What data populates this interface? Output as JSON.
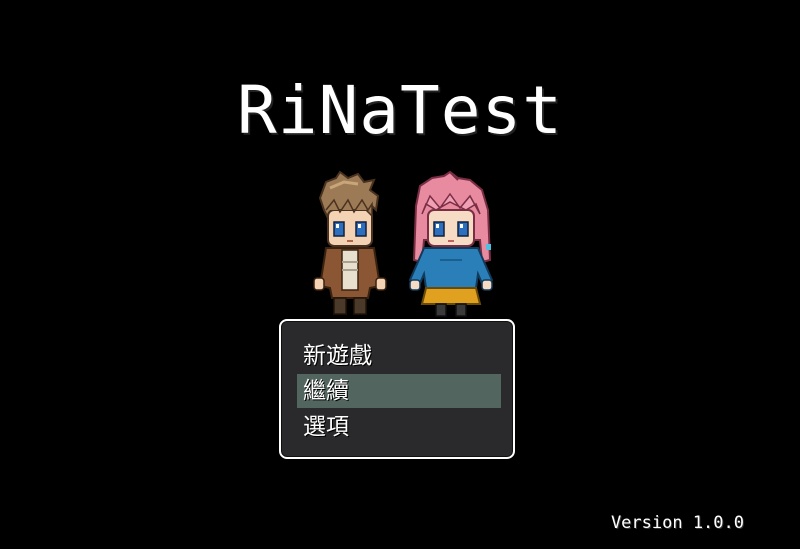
{
  "game": {
    "title": "RiNaTest",
    "version": "Version 1.0.0"
  },
  "menu": {
    "items": [
      {
        "label": "新遊戲"
      },
      {
        "label": "繼續"
      },
      {
        "label": "選項"
      }
    ],
    "selected_index": 1
  },
  "colors": {
    "background": "#000000",
    "menu_background": "#2a2a2d",
    "selection": "#52665f",
    "text": "#ffffff"
  }
}
